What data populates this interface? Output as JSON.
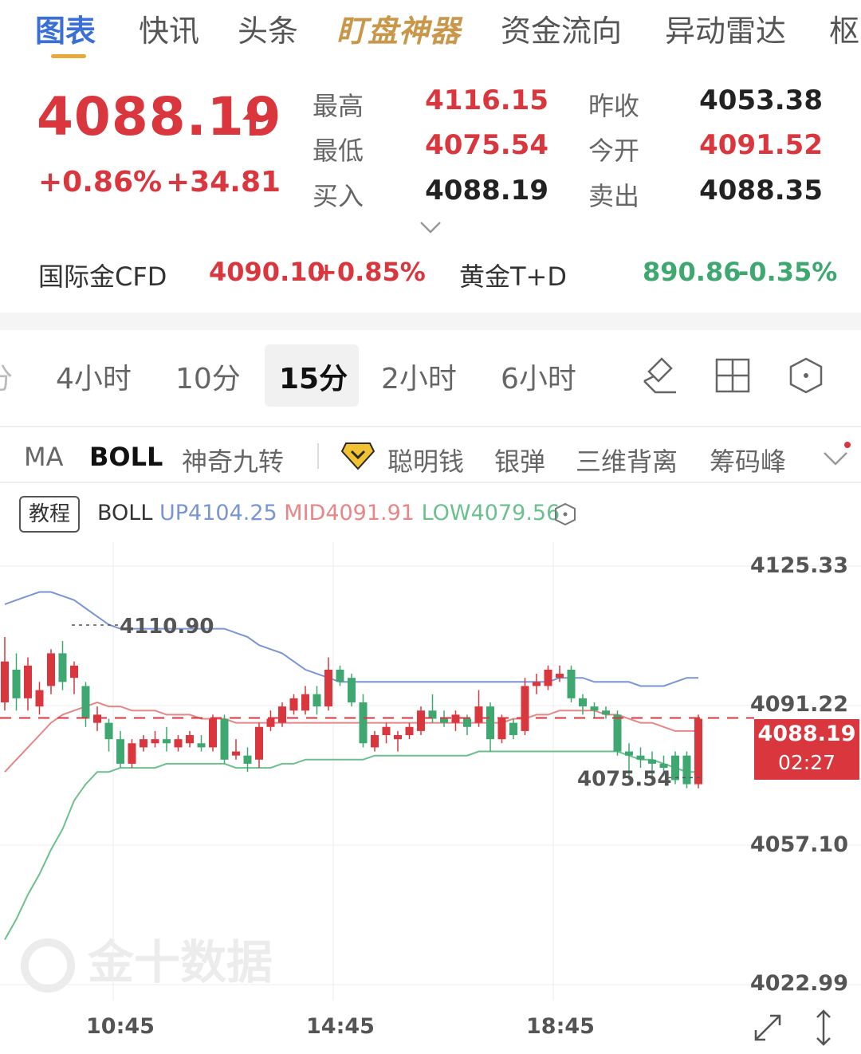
{
  "top_tabs": [
    {
      "label": "图表",
      "active": true
    },
    {
      "label": "快讯"
    },
    {
      "label": "头条"
    },
    {
      "label": "盯盘神器",
      "special": true
    },
    {
      "label": "资金流向"
    },
    {
      "label": "异动雷达"
    },
    {
      "label": "枢"
    }
  ],
  "quote": {
    "price": "4088.19",
    "change_pct": "+0.86%",
    "change": "+34.81",
    "high_label": "最高",
    "high": "4116.15",
    "low_label": "最低",
    "low": "4075.54",
    "bid_label": "买入",
    "bid": "4088.19",
    "prev_close_label": "昨收",
    "prev_close": "4053.38",
    "open_label": "今开",
    "open": "4091.52",
    "ask_label": "卖出",
    "ask": "4088.35"
  },
  "refs": {
    "cfd_name": "国际金CFD",
    "cfd_price": "4090.10",
    "cfd_pct": "+0.85%",
    "td_name": "黄金T+D",
    "td_price": "890.86",
    "td_pct": "-0.35%"
  },
  "periods": [
    {
      "label": "分"
    },
    {
      "label": "4小时"
    },
    {
      "label": "10分"
    },
    {
      "label": "15分",
      "active": true
    },
    {
      "label": "2小时"
    },
    {
      "label": "6小时"
    }
  ],
  "tools": [
    "draw-pen-icon",
    "grid-layout-icon",
    "hexagon-settings-icon"
  ],
  "indicators": [
    {
      "label": "MA"
    },
    {
      "label": "BOLL",
      "active": true
    },
    {
      "label": "神奇九转"
    },
    {
      "label": "聪明钱",
      "premium": true
    },
    {
      "label": "银弹"
    },
    {
      "label": "三维背离"
    },
    {
      "label": "筹码峰"
    }
  ],
  "boll": {
    "tutorial": "教程",
    "name": "BOLL",
    "up": "UP4104.25",
    "mid": "MID4091.91",
    "low": "LOW4079.56"
  },
  "colors": {
    "up": "#d9363e",
    "down": "#3ea870",
    "boll_up": "#7a95d6",
    "boll_mid": "#e88585",
    "boll_low": "#6cc08e",
    "accent": "#3a6fd8"
  },
  "chart_data": {
    "type": "candlestick",
    "y_axis_ticks": [
      "4125.33",
      "4091.22",
      "4057.10",
      "4022.99"
    ],
    "x_axis_ticks": [
      "10:45",
      "14:45",
      "18:45"
    ],
    "ylim": [
      4022.99,
      4125.33
    ],
    "current_price": "4088.19",
    "countdown": "02:27",
    "annotations": {
      "high": "4110.90",
      "low": "4075.54"
    },
    "candles": [
      {
        "o": 4092,
        "c": 4102,
        "h": 4108,
        "l": 4090
      },
      {
        "o": 4100,
        "c": 4093,
        "h": 4104,
        "l": 4090
      },
      {
        "o": 4093,
        "c": 4101,
        "h": 4103,
        "l": 4090
      },
      {
        "o": 4091,
        "c": 4095,
        "h": 4097,
        "l": 4089
      },
      {
        "o": 4096,
        "c": 4104,
        "h": 4105,
        "l": 4094
      },
      {
        "o": 4104,
        "c": 4097,
        "h": 4107,
        "l": 4095
      },
      {
        "o": 4098,
        "c": 4101,
        "h": 4102,
        "l": 4094
      },
      {
        "o": 4096,
        "c": 4088,
        "h": 4097,
        "l": 4086
      },
      {
        "o": 4087,
        "c": 4089,
        "h": 4091,
        "l": 4085
      },
      {
        "o": 4087,
        "c": 4083,
        "h": 4088,
        "l": 4080
      },
      {
        "o": 4083,
        "c": 4077,
        "h": 4085,
        "l": 4076
      },
      {
        "o": 4077,
        "c": 4082,
        "h": 4083,
        "l": 4076
      },
      {
        "o": 4081,
        "c": 4083,
        "h": 4084,
        "l": 4080
      },
      {
        "o": 4082,
        "c": 4083,
        "h": 4085,
        "l": 4081
      },
      {
        "o": 4083,
        "c": 4082,
        "h": 4086,
        "l": 4080
      },
      {
        "o": 4081,
        "c": 4083,
        "h": 4084,
        "l": 4080
      },
      {
        "o": 4082,
        "c": 4084,
        "h": 4085,
        "l": 4081
      },
      {
        "o": 4082,
        "c": 4081,
        "h": 4084,
        "l": 4080
      },
      {
        "o": 4081,
        "c": 4088,
        "h": 4089,
        "l": 4080
      },
      {
        "o": 4088,
        "c": 4078,
        "h": 4089,
        "l": 4077
      },
      {
        "o": 4079,
        "c": 4080,
        "h": 4083,
        "l": 4078
      },
      {
        "o": 4079,
        "c": 4077,
        "h": 4081,
        "l": 4075
      },
      {
        "o": 4078,
        "c": 4086,
        "h": 4087,
        "l": 4076
      },
      {
        "o": 4086,
        "c": 4088,
        "h": 4090,
        "l": 4085
      },
      {
        "o": 4087,
        "c": 4091,
        "h": 4092,
        "l": 4086
      },
      {
        "o": 4090,
        "c": 4093,
        "h": 4094,
        "l": 4089
      },
      {
        "o": 4090,
        "c": 4094,
        "h": 4096,
        "l": 4089
      },
      {
        "o": 4094,
        "c": 4091,
        "h": 4096,
        "l": 4089
      },
      {
        "o": 4091,
        "c": 4100,
        "h": 4103,
        "l": 4090
      },
      {
        "o": 4100,
        "c": 4097,
        "h": 4101,
        "l": 4096
      },
      {
        "o": 4098,
        "c": 4092,
        "h": 4099,
        "l": 4091
      },
      {
        "o": 4092,
        "c": 4082,
        "h": 4094,
        "l": 4081
      },
      {
        "o": 4081,
        "c": 4084,
        "h": 4085,
        "l": 4080
      },
      {
        "o": 4084,
        "c": 4086,
        "h": 4087,
        "l": 4082
      },
      {
        "o": 4083,
        "c": 4084,
        "h": 4085,
        "l": 4080
      },
      {
        "o": 4084,
        "c": 4086,
        "h": 4087,
        "l": 4083
      },
      {
        "o": 4085,
        "c": 4090,
        "h": 4091,
        "l": 4084
      },
      {
        "o": 4090,
        "c": 4088,
        "h": 4094,
        "l": 4087
      },
      {
        "o": 4088,
        "c": 4087,
        "h": 4090,
        "l": 4086
      },
      {
        "o": 4087,
        "c": 4089,
        "h": 4090,
        "l": 4085
      },
      {
        "o": 4088,
        "c": 4086,
        "h": 4089,
        "l": 4084
      },
      {
        "o": 4087,
        "c": 4091,
        "h": 4095,
        "l": 4086
      },
      {
        "o": 4091,
        "c": 4083,
        "h": 4092,
        "l": 4080
      },
      {
        "o": 4083,
        "c": 4088,
        "h": 4089,
        "l": 4082
      },
      {
        "o": 4087,
        "c": 4084,
        "h": 4088,
        "l": 4083
      },
      {
        "o": 4085,
        "c": 4096,
        "h": 4098,
        "l": 4084
      },
      {
        "o": 4096,
        "c": 4097,
        "h": 4099,
        "l": 4094
      },
      {
        "o": 4096,
        "c": 4100,
        "h": 4101,
        "l": 4095
      },
      {
        "o": 4098,
        "c": 4099,
        "h": 4101,
        "l": 4097
      },
      {
        "o": 4100,
        "c": 4093,
        "h": 4101,
        "l": 4092
      },
      {
        "o": 4093,
        "c": 4091,
        "h": 4094,
        "l": 4089
      },
      {
        "o": 4091,
        "c": 4090,
        "h": 4092,
        "l": 4088
      },
      {
        "o": 4090,
        "c": 4089,
        "h": 4091,
        "l": 4088
      },
      {
        "o": 4089,
        "c": 4080,
        "h": 4090,
        "l": 4079
      },
      {
        "o": 4080,
        "c": 4079,
        "h": 4082,
        "l": 4073
      },
      {
        "o": 4079,
        "c": 4078,
        "h": 4081,
        "l": 4076
      },
      {
        "o": 4078,
        "c": 4077,
        "h": 4080,
        "l": 4074
      },
      {
        "o": 4077,
        "c": 4076,
        "h": 4079,
        "l": 4074
      },
      {
        "o": 4079,
        "c": 4073,
        "h": 4080,
        "l": 4072
      },
      {
        "o": 4079,
        "c": 4072,
        "h": 4080,
        "l": 4071
      },
      {
        "o": 4072,
        "c": 4088,
        "h": 4089,
        "l": 4071
      }
    ],
    "boll_up": [
      4116,
      4117,
      4118,
      4119,
      4119,
      4118,
      4117,
      4115,
      4113,
      4111,
      4110,
      4110,
      4110,
      4110,
      4110,
      4110,
      4110,
      4110,
      4110,
      4110,
      4109,
      4108,
      4106,
      4105,
      4104,
      4102,
      4100,
      4099,
      4098,
      4097,
      4097,
      4097,
      4097,
      4097,
      4097,
      4097,
      4097,
      4097,
      4097,
      4097,
      4097,
      4097,
      4097,
      4097,
      4097,
      4097,
      4097,
      4097,
      4098,
      4098,
      4098,
      4097,
      4097,
      4097,
      4097,
      4096,
      4096,
      4096,
      4097,
      4098,
      4098
    ],
    "boll_mid": [
      4075,
      4078,
      4081,
      4084,
      4087,
      4089,
      4090,
      4091,
      4092,
      4091,
      4091,
      4090,
      4090,
      4090,
      4089,
      4089,
      4089,
      4088,
      4088,
      4088,
      4087,
      4087,
      4087,
      4087,
      4087,
      4087,
      4087,
      4087,
      4087,
      4087,
      4087,
      4087,
      4087,
      4087,
      4087,
      4087,
      4087,
      4087,
      4087,
      4087,
      4087,
      4087,
      4087,
      4087,
      4088,
      4088,
      4089,
      4089,
      4090,
      4090,
      4090,
      4090,
      4089,
      4089,
      4088,
      4087,
      4087,
      4086,
      4085,
      4085,
      4085
    ],
    "boll_low": [
      4034,
      4039,
      4045,
      4050,
      4056,
      4061,
      4068,
      4072,
      4075,
      4075,
      4076,
      4076,
      4076,
      4076,
      4077,
      4077,
      4077,
      4077,
      4077,
      4077,
      4076,
      4076,
      4076,
      4076,
      4077,
      4077,
      4078,
      4078,
      4078,
      4078,
      4078,
      4078,
      4079,
      4079,
      4079,
      4079,
      4079,
      4079,
      4079,
      4079,
      4079,
      4080,
      4080,
      4080,
      4080,
      4080,
      4080,
      4080,
      4080,
      4080,
      4080,
      4080,
      4080,
      4080,
      4079,
      4078,
      4078,
      4077,
      4076,
      4075,
      4075
    ]
  },
  "watermark": "金十数据"
}
